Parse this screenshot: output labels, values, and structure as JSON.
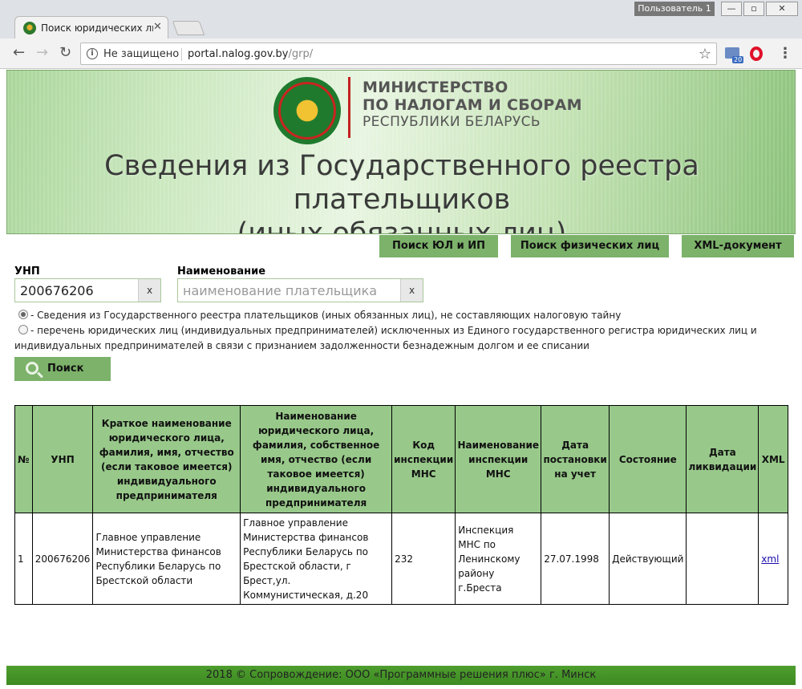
{
  "browser": {
    "tab_title": "Поиск юридических ли",
    "user_badge": "Пользователь 1",
    "security_text": "Не защищено",
    "url_host": "portal.nalog.gov.by",
    "url_path": "/grp/",
    "mail_badge": "20"
  },
  "banner": {
    "ministry_line1": "МИНИСТЕРСТВО",
    "ministry_line2": "ПО НАЛОГАМ И СБОРАМ",
    "ministry_line3": "РЕСПУБЛИКИ БЕЛАРУСЬ",
    "title_line1": "Сведения из Государственного реестра плательщиков",
    "title_line2": "(иных обязанных лиц)"
  },
  "nav": {
    "search_legal": "Поиск ЮЛ и ИП",
    "search_individuals": "Поиск физических лиц",
    "xml_document": "XML-документ"
  },
  "form": {
    "unp_label": "УНП",
    "unp_value": "200676206",
    "name_label": "Наименование",
    "name_placeholder": "наименование плательщика",
    "clear": "x",
    "radio1": "- Сведения из Государственного реестра плательщиков (иных обязанных лиц), не составляющих налоговую тайну",
    "radio2_line1": "- перечень юридических лиц (индивидуальных предпринимателей) исключенных из Единого государственного регистра юридических лиц и",
    "radio2_line2": "индивидуальных предпринимателей в связи с признанием задолженности безнадежным долгом и ее списании",
    "search_button": "Поиск"
  },
  "table": {
    "headers": [
      "№",
      "УНП",
      "Краткое наименование юридического лица, фамилия, имя, отчество (если таковое имеется) индивидуального предпринимателя",
      "Наименование юридического лица, фамилия, собственное имя, отчество (если таковое имеется) индивидуального предпринимателя",
      "Код инспекции МНС",
      "Наименование инспекции МНС",
      "Дата постановки на учет",
      "Состояние",
      "Дата ликвидации",
      "XML"
    ],
    "rows": [
      {
        "num": "1",
        "unp": "200676206",
        "short_name": "Главное управление Министерства финансов Республики Беларусь по Брестской области",
        "full_name": "Главное управление Министерства финансов Республики Беларусь по Брестской области, г Брест,ул. Коммунистическая, д.20",
        "inspection_code": "232",
        "inspection_name": "Инспекция МНС по Ленинскому району г.Бреста",
        "registration_date": "27.07.1998",
        "status": "Действующий",
        "liquidation_date": "",
        "xml": "xml"
      }
    ]
  },
  "footer": "2018 © Сопровождение: ООО «Программные решения плюс» г. Минск"
}
